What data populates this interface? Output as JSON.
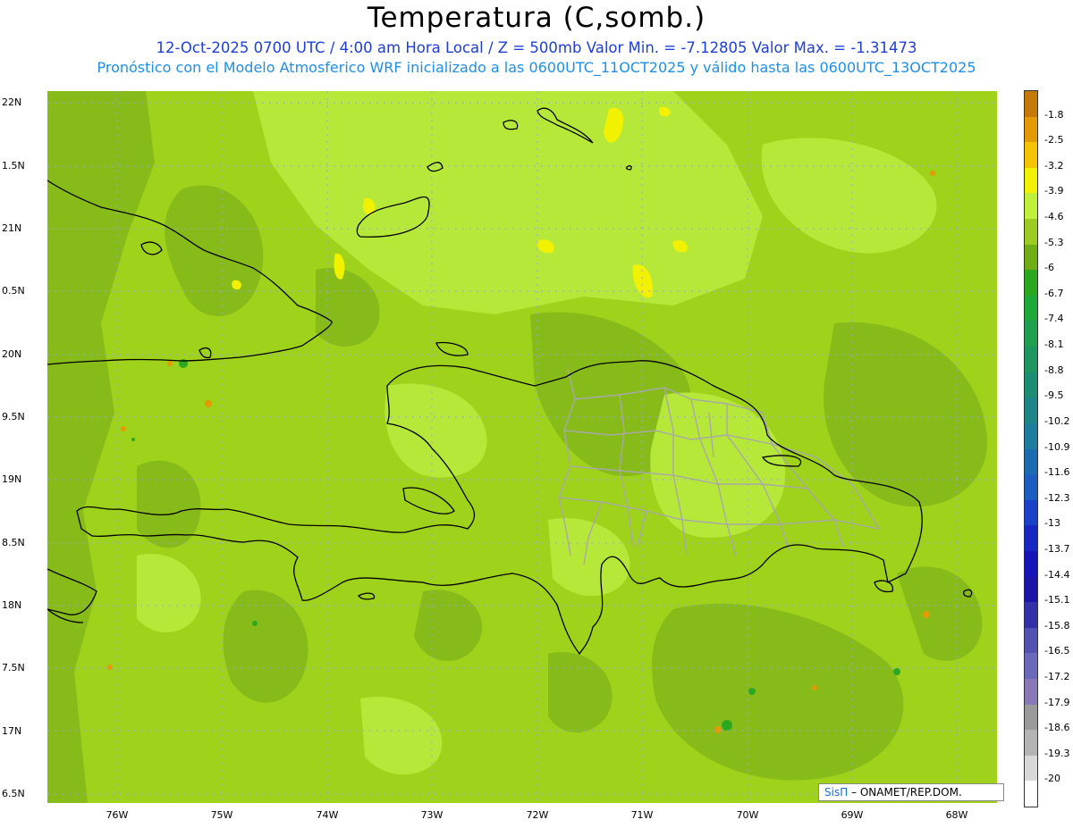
{
  "header": {
    "title": "Temperatura (C,somb.)",
    "subtitle": "12-Oct-2025  0700 UTC / 4:00 am Hora Local / Z = 500mb  Valor Min. = -7.12805  Valor Max. = -1.31473",
    "info": "Pronóstico con el Modelo Atmosferico WRF inicializado a las 0600UTC_11OCT2025 y válido hasta las  0600UTC_13OCT2025"
  },
  "axes": {
    "lat_labels": [
      "22N",
      "1.5N",
      "21N",
      "0.5N",
      "20N",
      "9.5N",
      "19N",
      "8.5N",
      "18N",
      "7.5N",
      "17N",
      "6.5N"
    ],
    "lon_labels": [
      "76W",
      "75W",
      "74W",
      "73W",
      "72W",
      "71W",
      "70W",
      "69W",
      "68W"
    ]
  },
  "colorbar": {
    "labels": [
      "-1.8",
      "-2.5",
      "-3.2",
      "-3.9",
      "-4.6",
      "-5.3",
      "-6",
      "-6.7",
      "-7.4",
      "-8.1",
      "-8.8",
      "-9.5",
      "-10.2",
      "-10.9",
      "-11.6",
      "-12.3",
      "-13",
      "-13.7",
      "-14.4",
      "-15.1",
      "-15.8",
      "-16.5",
      "-17.2",
      "-17.9",
      "-18.6",
      "-19.3",
      "-20"
    ],
    "colors": [
      "#c47a08",
      "#e29a05",
      "#f5c400",
      "#f2f200",
      "#bff03a",
      "#9ccc22",
      "#6fae14",
      "#2ca820",
      "#1ea83a",
      "#20a04e",
      "#1f9660",
      "#1e8c74",
      "#1e8488",
      "#1e7c9c",
      "#1e6cb0",
      "#1e5cc0",
      "#1a42c8",
      "#1628c4",
      "#1414b8",
      "#1a14a8",
      "#3430a8",
      "#5252b0",
      "#6a6ab8",
      "#8878b8",
      "#9a9a9a",
      "#b4b4b4",
      "#d8d8d8",
      "#ffffff"
    ]
  },
  "credit": {
    "brand": "SisΠ",
    "text": " – ONAMET/REP.DOM."
  }
}
